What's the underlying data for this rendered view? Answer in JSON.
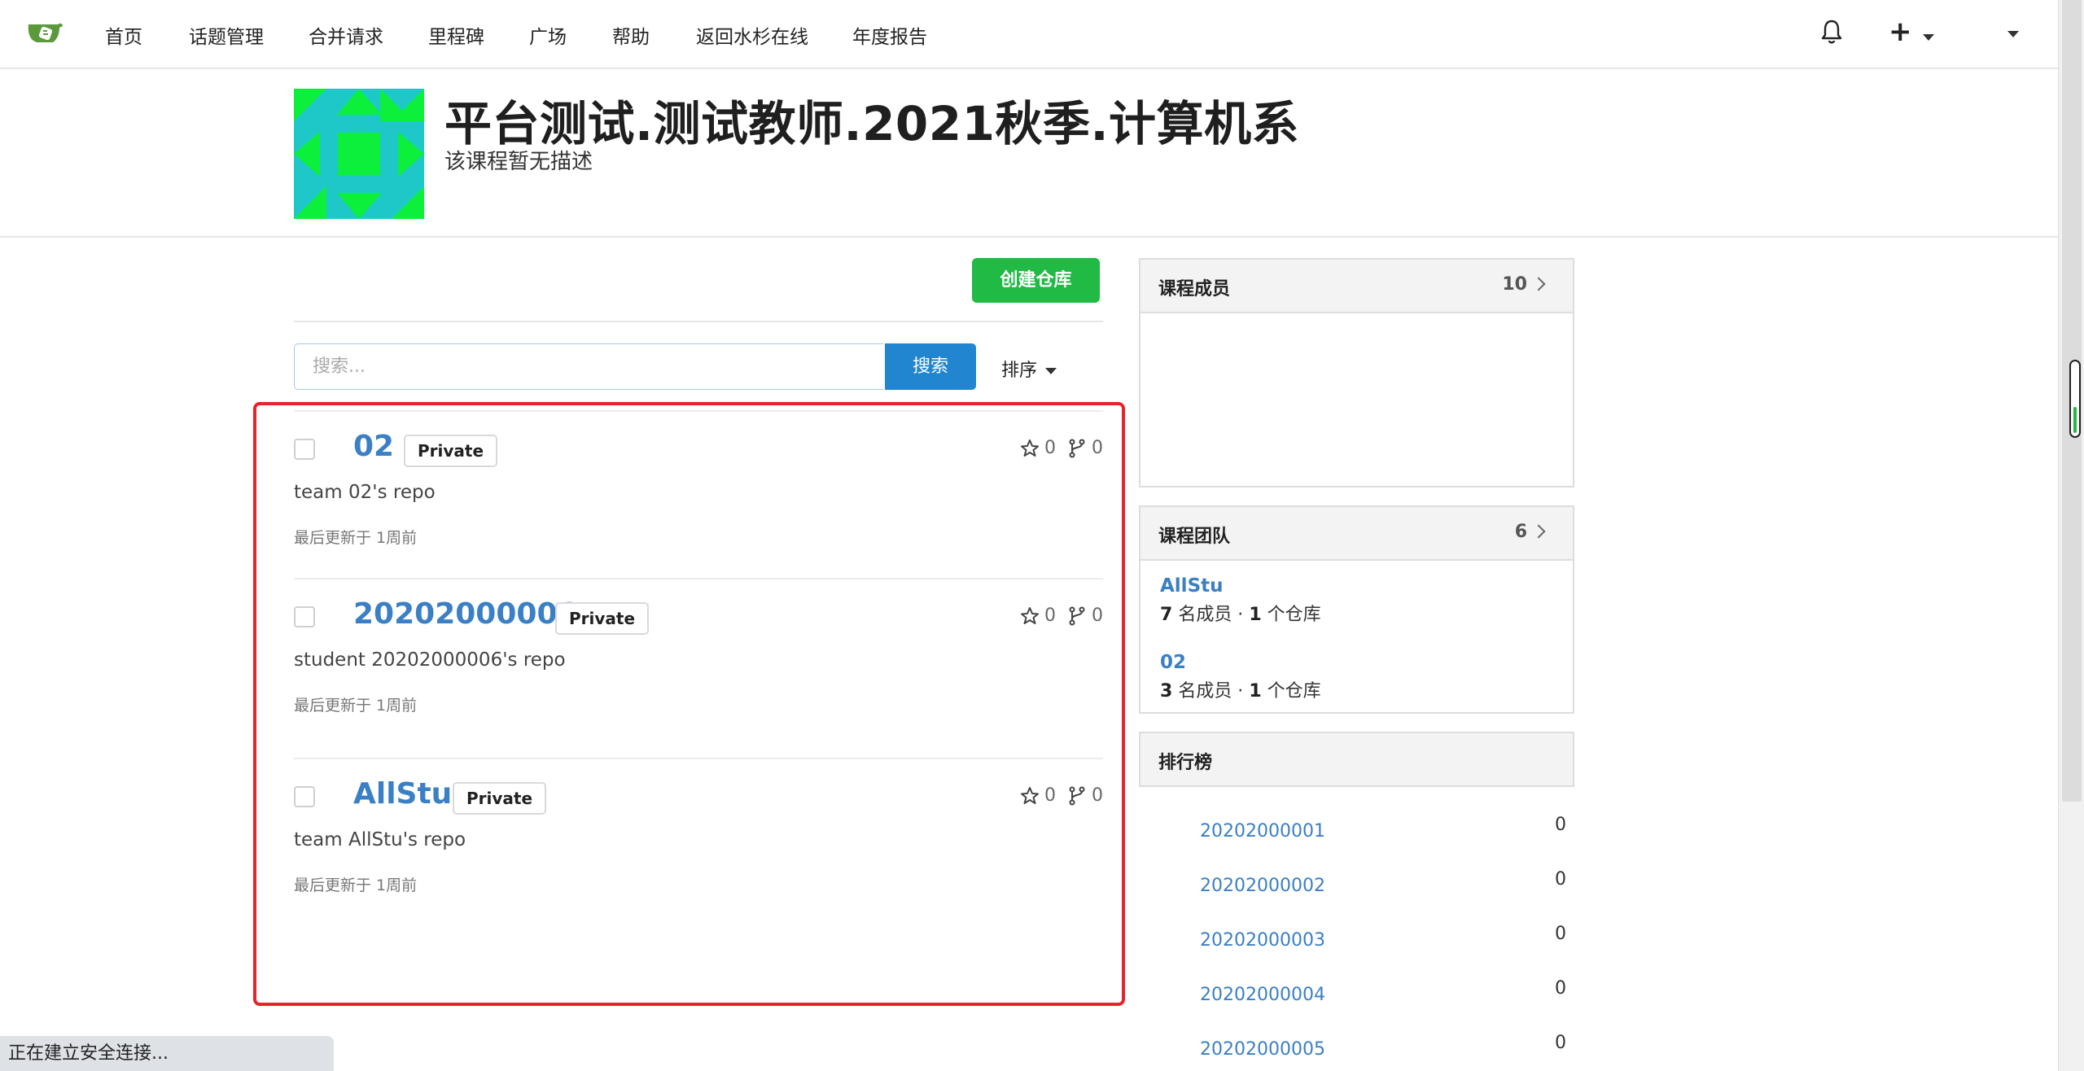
{
  "nav": {
    "items": [
      "首页",
      "话题管理",
      "合并请求",
      "里程碑",
      "广场",
      "帮助",
      "返回水杉在线",
      "年度报告"
    ]
  },
  "course": {
    "title": "平台测试.测试教师.2021秋季.计算机系",
    "description": "该课程暂无描述"
  },
  "actions": {
    "create_repo": "创建仓库",
    "search_placeholder": "搜索...",
    "search_button": "搜索",
    "sort_label": "排序"
  },
  "repos": [
    {
      "name": "02",
      "visibility": "Private",
      "description": "team 02's repo",
      "updated": "最后更新于 1周前",
      "stars": "0",
      "forks": "0"
    },
    {
      "name": "20202000006",
      "visibility": "Private",
      "description": "student 20202000006's repo",
      "updated": "最后更新于 1周前",
      "stars": "0",
      "forks": "0"
    },
    {
      "name": "AllStu",
      "visibility": "Private",
      "description": "team AllStu's repo",
      "updated": "最后更新于 1周前",
      "stars": "0",
      "forks": "0"
    }
  ],
  "members_panel": {
    "title": "课程成员",
    "count": "10"
  },
  "teams_panel": {
    "title": "课程团队",
    "count": "6",
    "teams": [
      {
        "name": "AllStu",
        "members": "7",
        "members_label": "名成员 ·",
        "repos": "1",
        "repos_label": "个仓库"
      },
      {
        "name": "02",
        "members": "3",
        "members_label": "名成员 ·",
        "repos": "1",
        "repos_label": "个仓库"
      }
    ]
  },
  "ranking_panel": {
    "title": "排行榜",
    "rows": [
      {
        "name": "20202000001",
        "score": "0"
      },
      {
        "name": "20202000002",
        "score": "0"
      },
      {
        "name": "20202000003",
        "score": "0"
      },
      {
        "name": "20202000004",
        "score": "0"
      },
      {
        "name": "20202000005",
        "score": "0"
      }
    ]
  },
  "status_bar": {
    "text": "正在建立安全连接..."
  },
  "colors": {
    "accent_blue": "#2185d0",
    "create_green": "#21ba45",
    "highlight_red": "#e8232b",
    "link_blue": "#3b7fc4"
  }
}
